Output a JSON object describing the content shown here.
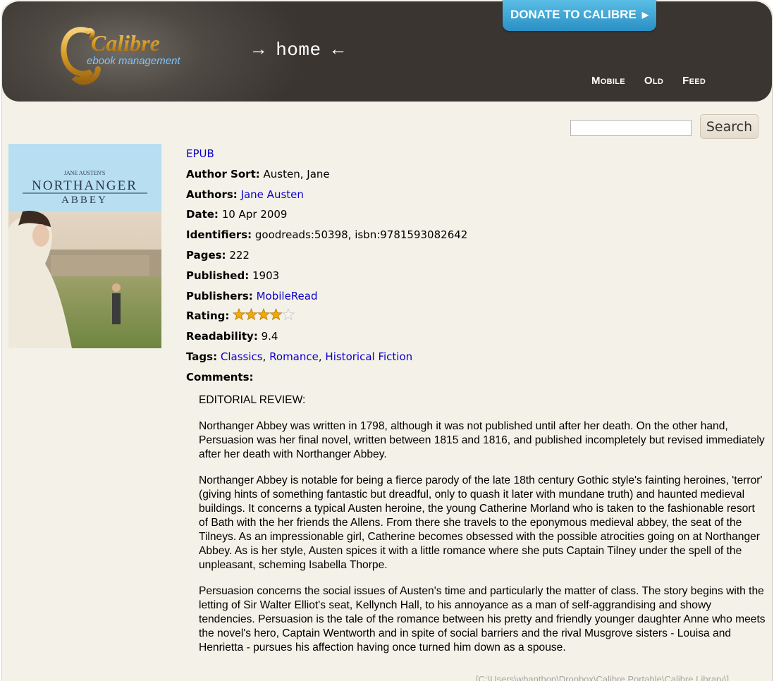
{
  "header": {
    "logo_title": "Calibre",
    "logo_subtitle": "ebook management",
    "home_text": "→ home ←",
    "donate_label": "DONATE TO CALIBRE",
    "nav": [
      "Mobile",
      "Old",
      "Feed"
    ]
  },
  "search": {
    "placeholder": "",
    "button_label": "Search"
  },
  "cover": {
    "author_line": "JANE AUSTEN'S",
    "title_line1": "NORTHANGER",
    "title_line2": "ABBEY"
  },
  "book": {
    "format": "EPUB",
    "author_sort_label": "Author Sort:",
    "author_sort": "Austen, Jane",
    "authors_label": "Authors:",
    "authors": "Jane Austen",
    "date_label": "Date:",
    "date": "10 Apr 2009",
    "identifiers_label": "Identifiers:",
    "identifiers": "goodreads:50398, isbn:9781593082642",
    "pages_label": "Pages:",
    "pages": "222",
    "published_label": "Published:",
    "published": "1903",
    "publishers_label": "Publishers:",
    "publishers": "MobileRead",
    "rating_label": "Rating:",
    "rating": 4,
    "rating_max": 5,
    "readability_label": "Readability:",
    "readability": "9.4",
    "tags_label": "Tags:",
    "tags": [
      "Classics",
      "Romance",
      "Historical Fiction"
    ],
    "comments_label": "Comments:"
  },
  "comments": {
    "heading": "EDITORIAL REVIEW:",
    "paragraphs": [
      "Northanger Abbey was written in 1798, although it was not published until after her death. On the other hand, Persuasion was her final novel, written between 1815 and 1816, and published incompletely but revised immediately after her death with Northanger Abbey.",
      "Northanger Abbey is notable for being a fierce parody of the late 18th century Gothic style's fainting heroines, 'terror' (giving hints of something fantastic but dreadful, only to quash it later with mundane truth) and haunted medieval buildings. It concerns a typical Austen heroine, the young Catherine Morland who is taken to the fashionable resort of Bath with the her friends the Allens. From there she travels to the eponymous medieval abbey, the seat of the Tilneys. As an impressionable girl, Catherine becomes obsessed with the possible atrocities going on at Northanger Abbey. As is her style, Austen spices it with a little romance where she puts Captain Tilney under the spell of the unpleasant, scheming Isabella Thorpe.",
      "Persuasion concerns the social issues of Austen's time and particularly the matter of class. The story begins with the letting of Sir Walter Elliot's seat, Kellynch Hall, to his annoyance as a man of self-aggrandising and showy tendencies. Persuasion is the tale of the romance between his pretty and friendly younger daughter Anne who meets the novel's hero, Captain Wentworth and in spite of social barriers and the rival Musgrove sisters - Louisa and Henrietta - pursues his affection having once turned him down as a spouse."
    ]
  },
  "footer": {
    "library_path": "[C:\\Users\\wbanthon\\Dropbox\\Calibre Portable\\Calibre Library\\]"
  },
  "colors": {
    "link": "#0a00c8",
    "header_bg": "#3b3531",
    "page_bg": "#f4f1e8",
    "donate": "#2a8fc3",
    "star": "#f2a900"
  }
}
